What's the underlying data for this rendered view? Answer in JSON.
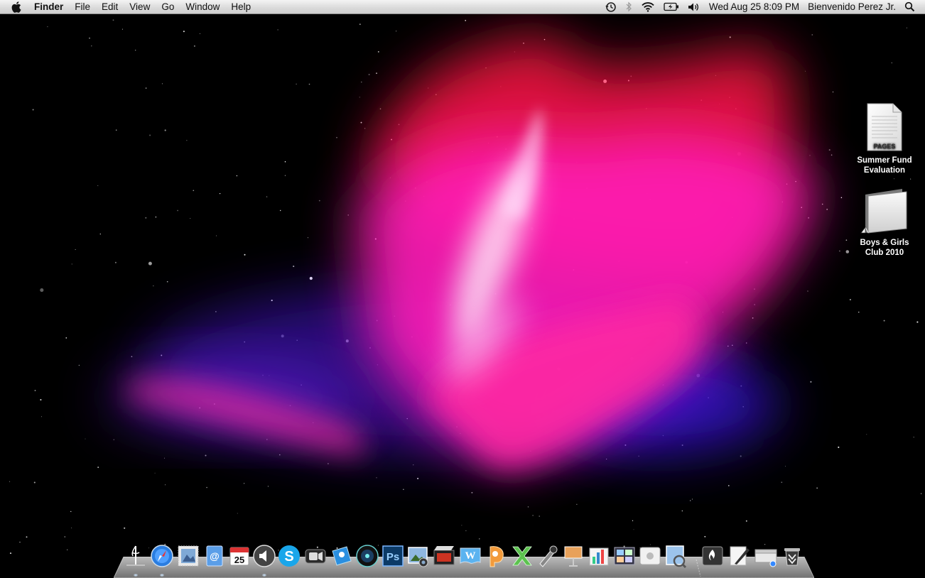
{
  "menubar": {
    "app_name": "Finder",
    "menus": [
      "File",
      "Edit",
      "View",
      "Go",
      "Window",
      "Help"
    ],
    "clock": "Wed Aug 25  8:09 PM",
    "user": "Bienvenido Perez Jr."
  },
  "desktop_icons": [
    {
      "label_line1": "Summer Fund",
      "label_line2": "Evaluation",
      "badge": "PAGES",
      "kind": "pages-document-icon"
    },
    {
      "label_line1": "Boys & Girls",
      "label_line2": "Club 2010",
      "kind": "folder-alias-icon"
    }
  ],
  "dock": {
    "calendar_day": "25",
    "photoshop_label": "Ps",
    "apps": [
      "finder-icon",
      "safari-icon",
      "mail-stamp-icon",
      "address-book-icon",
      "ical-icon",
      "speaker-icon",
      "skype-icon",
      "facetime-icon",
      "iweb-icon",
      "itunes-icon",
      "photoshop-icon",
      "iphoto-icon",
      "imovie-icon",
      "word-icon",
      "powerpoint-icon",
      "excel-icon",
      "script-editor-icon",
      "keynote-icon",
      "numbers-icon",
      "dashboard-icon",
      "app-store-icon",
      "preview-icon",
      "burn-icon",
      "textedit-icon",
      "scanner-icon",
      "trash-icon"
    ]
  },
  "colors": {
    "aurora_pink": "#ff2db4",
    "aurora_red": "#ff1440",
    "aurora_violet": "#7a1cff",
    "night": "#000000"
  }
}
